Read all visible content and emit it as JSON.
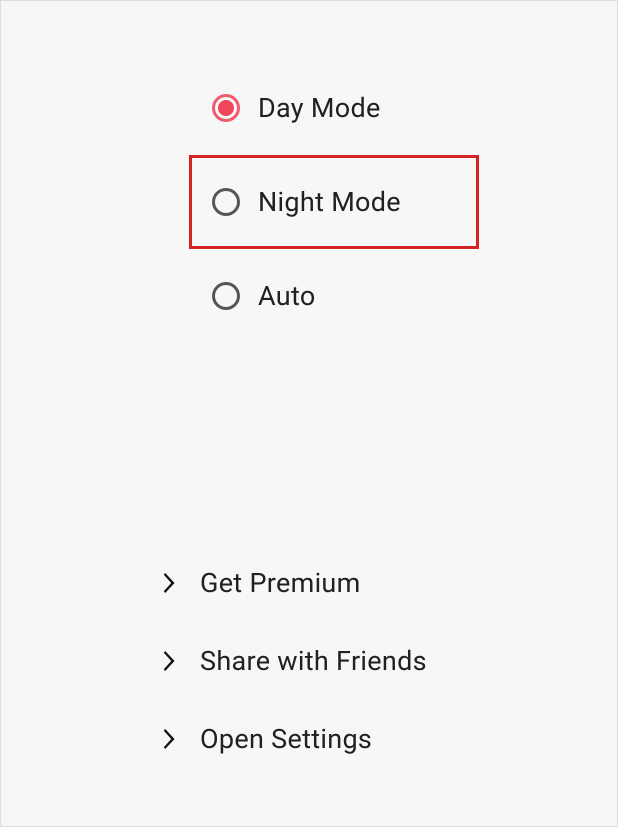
{
  "modes": {
    "day": {
      "label": "Day Mode",
      "selected": true,
      "highlighted": false
    },
    "night": {
      "label": "Night Mode",
      "selected": false,
      "highlighted": true
    },
    "auto": {
      "label": "Auto",
      "selected": false,
      "highlighted": false
    }
  },
  "menu": {
    "premium": {
      "label": "Get Premium"
    },
    "share": {
      "label": "Share with Friends"
    },
    "settings": {
      "label": "Open Settings"
    }
  },
  "colors": {
    "accent": "#f0455b",
    "highlight_border": "#d32323"
  }
}
